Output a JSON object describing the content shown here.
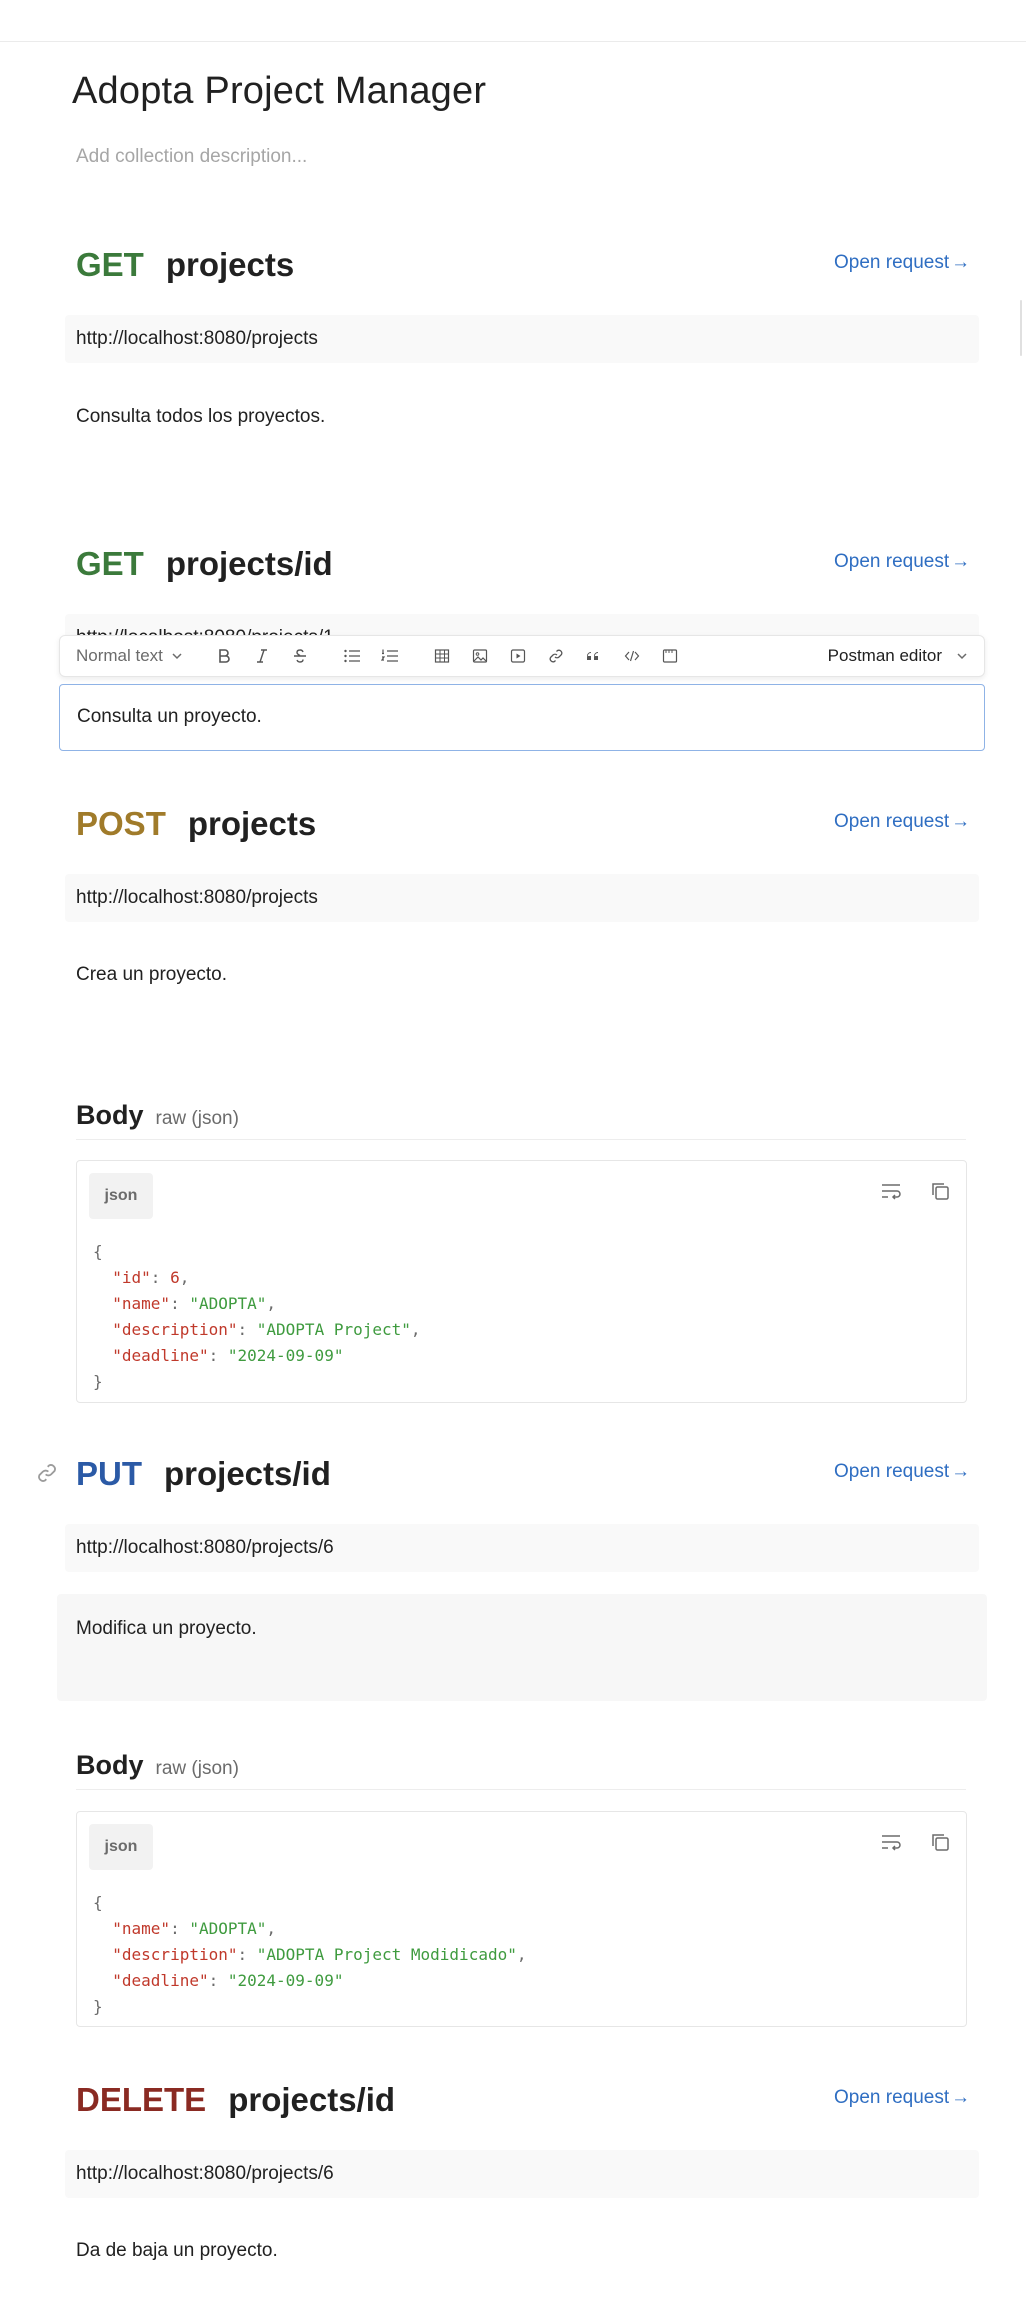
{
  "collection": {
    "title": "Adopta Project Manager",
    "description_placeholder": "Add collection description..."
  },
  "open_request_label": "Open request",
  "open_request_arrow": "→",
  "requests": [
    {
      "method": "GET",
      "name": "projects",
      "url": "http://localhost:8080/projects",
      "description": "Consulta todos los proyectos."
    },
    {
      "method": "GET",
      "name": "projects/id",
      "url": "http://localhost:8080/projects/1",
      "description": "Consulta un proyecto."
    },
    {
      "method": "POST",
      "name": "projects",
      "url": "http://localhost:8080/projects",
      "description": "Crea un proyecto.",
      "body": {
        "title": "Body",
        "type": "raw (json)",
        "lang": "json"
      }
    },
    {
      "method": "PUT",
      "name": "projects/id",
      "url": "http://localhost:8080/projects/6",
      "description": "Modifica un proyecto.",
      "body": {
        "title": "Body",
        "type": "raw (json)",
        "lang": "json"
      }
    },
    {
      "method": "DELETE",
      "name": "projects/id",
      "url": "http://localhost:8080/projects/6",
      "description": "Da de baja un proyecto."
    }
  ],
  "post_body_json": {
    "open": "{",
    "close": "}",
    "lines": [
      {
        "key": "\"id\"",
        "value": "6",
        "kind": "number"
      },
      {
        "key": "\"name\"",
        "value": "\"ADOPTA\"",
        "kind": "string"
      },
      {
        "key": "\"description\"",
        "value": "\"ADOPTA Project\"",
        "kind": "string"
      },
      {
        "key": "\"deadline\"",
        "value": "\"2024-09-09\"",
        "kind": "string"
      }
    ]
  },
  "put_body_json": {
    "open": "{",
    "close": "}",
    "lines": [
      {
        "key": "\"name\"",
        "value": "\"ADOPTA\"",
        "kind": "string"
      },
      {
        "key": "\"description\"",
        "value": "\"ADOPTA Project Modidicado\"",
        "kind": "string"
      },
      {
        "key": "\"deadline\"",
        "value": "\"2024-09-09\"",
        "kind": "string"
      }
    ]
  },
  "toolbar": {
    "text_style": "Normal text",
    "editor": "Postman editor",
    "icons": [
      "bold-icon",
      "italic-icon",
      "strikethrough-icon",
      "bullet-list-icon",
      "numbered-list-icon",
      "table-icon",
      "image-icon",
      "video-icon",
      "link-icon",
      "quote-icon",
      "code-icon",
      "code-block-icon"
    ]
  }
}
